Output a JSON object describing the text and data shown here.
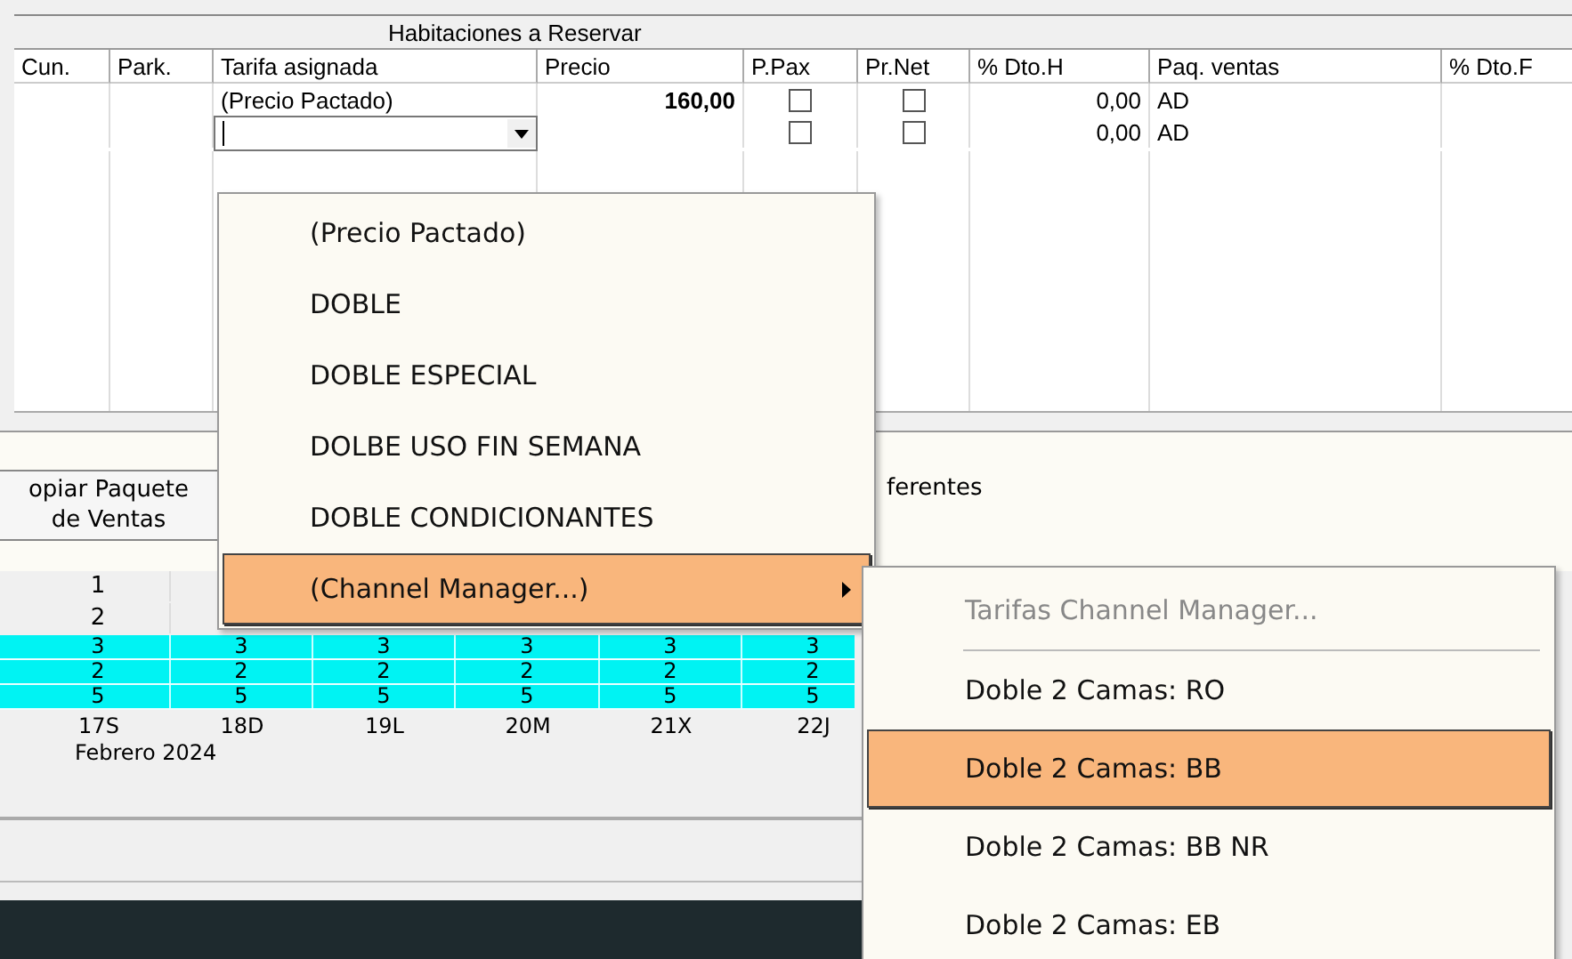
{
  "table": {
    "group_title": "Habitaciones a Reservar",
    "columns": [
      "Cun.",
      "Park.",
      "Tarifa asignada",
      "Precio",
      "P.Pax",
      "Pr.Net",
      "% Dto.H",
      "Paq. ventas",
      "% Dto.F"
    ],
    "rows": [
      {
        "kind": "text",
        "tarifa": "(Precio Pactado)",
        "precio": "160,00",
        "p_pax": false,
        "pr_net": false,
        "dto_h": "0,00",
        "paq_ventas": "AD"
      },
      {
        "kind": "editor",
        "p_pax": false,
        "pr_net": false,
        "dto_h": "0,00",
        "paq_ventas": "AD"
      }
    ]
  },
  "copy_button": {
    "lines": [
      "opiar Paquete",
      "de Ventas"
    ]
  },
  "note": "ferentes",
  "calendar": {
    "rows": [
      {
        "kind": "plain",
        "cells": [
          "1"
        ]
      },
      {
        "kind": "plain",
        "cells": [
          "2"
        ]
      },
      {
        "kind": "highlight",
        "cells": [
          "3",
          "3",
          "3",
          "3",
          "3",
          "3"
        ]
      },
      {
        "kind": "highlight",
        "cells": [
          "2",
          "2",
          "2",
          "2",
          "2",
          "2"
        ]
      },
      {
        "kind": "highlight",
        "cells": [
          "5",
          "5",
          "5",
          "5",
          "5",
          "5"
        ]
      }
    ],
    "dates": [
      "17S",
      "18D",
      "19L",
      "20M",
      "21X",
      "22J"
    ],
    "month": "Febrero 2024"
  },
  "dropdown": {
    "items": [
      {
        "label": "(Precio Pactado)",
        "selected": false,
        "has_submenu": false
      },
      {
        "label": "DOBLE",
        "selected": false,
        "has_submenu": false
      },
      {
        "label": "DOBLE ESPECIAL",
        "selected": false,
        "has_submenu": false
      },
      {
        "label": "DOLBE USO FIN SEMANA",
        "selected": false,
        "has_submenu": false
      },
      {
        "label": "DOBLE CONDICIONANTES",
        "selected": false,
        "has_submenu": false
      },
      {
        "label": "(Channel Manager...)",
        "selected": true,
        "has_submenu": true
      }
    ]
  },
  "submenu": {
    "items": [
      {
        "kind": "caption",
        "label": "Tarifas Channel Manager...",
        "selected": false
      },
      {
        "kind": "item",
        "label": "Doble 2 Camas: RO",
        "selected": false
      },
      {
        "kind": "item",
        "label": "Doble 2 Camas: BB",
        "selected": true
      },
      {
        "kind": "item",
        "label": "Doble 2 Camas: BB NR",
        "selected": false
      },
      {
        "kind": "item",
        "label": "Doble 2 Camas: EB",
        "selected": false
      }
    ]
  }
}
